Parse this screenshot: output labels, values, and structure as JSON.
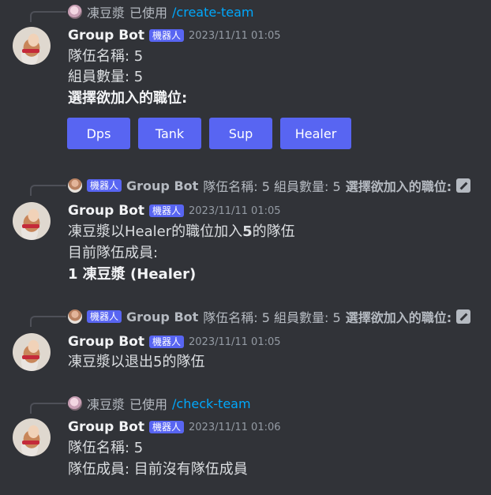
{
  "messages": [
    {
      "reply": {
        "user": "凍豆漿",
        "action": "已使用",
        "command": "/create-team"
      },
      "author": "Group Bot",
      "badge": "機器人",
      "timestamp": "2023/11/11 01:05",
      "lines": [
        "隊伍名稱: 5",
        "組員數量: 5",
        "選擇欲加入的職位:"
      ],
      "buttons": [
        "Dps",
        "Tank",
        "Sup",
        "Healer"
      ]
    },
    {
      "reply": {
        "badge": "機器人",
        "user": "Group Bot",
        "text": "隊伍名稱: 5 組員數量: 5",
        "text_bold": "選擇欲加入的職位:"
      },
      "author": "Group Bot",
      "badge": "機器人",
      "timestamp": "2023/11/11 01:05",
      "line1_a": "凍豆漿以Healer的職位加入",
      "line1_b": "5",
      "line1_c": "的隊伍",
      "line2": "目前隊伍成員:",
      "line3": "1 凍豆漿 (Healer)"
    },
    {
      "reply": {
        "badge": "機器人",
        "user": "Group Bot",
        "text": "隊伍名稱: 5 組員數量: 5",
        "text_bold": "選擇欲加入的職位:"
      },
      "author": "Group Bot",
      "badge": "機器人",
      "timestamp": "2023/11/11 01:05",
      "line1": "凍豆漿以退出5的隊伍"
    },
    {
      "reply": {
        "user": "凍豆漿",
        "action": "已使用",
        "command": "/check-team"
      },
      "author": "Group Bot",
      "badge": "機器人",
      "timestamp": "2023/11/11 01:06",
      "lines": [
        "隊伍名稱: 5",
        "隊伍成員: 目前沒有隊伍成員"
      ]
    }
  ],
  "colors": {
    "background": "#313338",
    "button": "#5865f2",
    "command": "#00a8fc",
    "badge": "#5865f2"
  }
}
